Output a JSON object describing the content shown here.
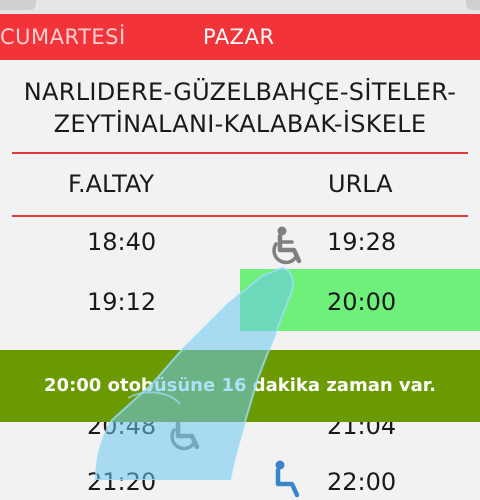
{
  "tabs": [
    {
      "label": "CUMARTESİ",
      "selected": false
    },
    {
      "label": "PAZAR",
      "selected": true
    }
  ],
  "route": {
    "line1": "NARLIDERE-GÜZELBAHÇE-SİTELER-",
    "line2": "ZEYTİNALANI-KALABAK-İSKELE"
  },
  "columns": {
    "left": "F.ALTAY",
    "right": "URLA"
  },
  "rows": [
    {
      "left": "18:40",
      "right": "19:28",
      "accessible": true
    },
    {
      "left": "19:12",
      "right": "20:00",
      "highlighted": true
    },
    {
      "left": "20:48",
      "right": "21:04",
      "accessible": true
    },
    {
      "left": "21:20",
      "right": "22:00",
      "accessible": true
    }
  ],
  "toast": {
    "message": "20:00 otobüsüne 16 dakika zaman var."
  },
  "colors": {
    "tab_bar": "#f2343a",
    "divider": "#e23a3a",
    "highlight": "#6ef07a",
    "toast_bg": "#6a9a00",
    "icon": "#808080"
  },
  "icons": {
    "accessible": "wheelchair-icon"
  }
}
